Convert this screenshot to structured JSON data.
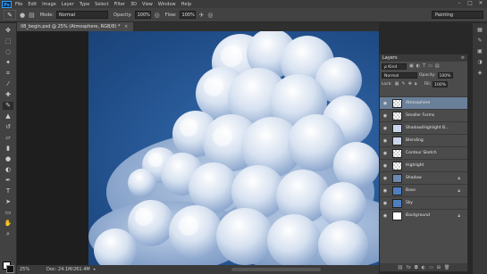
{
  "menubar": {
    "logo": "Ps",
    "items": [
      "File",
      "Edit",
      "Image",
      "Layer",
      "Type",
      "Select",
      "Filter",
      "3D",
      "View",
      "Window",
      "Help"
    ],
    "minimize": "–",
    "maximize": "□",
    "close": "✕"
  },
  "options": {
    "mode_label": "Mode:",
    "mode_value": "Normal",
    "opacity_label": "Opacity:",
    "opacity_value": "100%",
    "flow_label": "Flow:",
    "flow_value": "100%",
    "workspace": "Painting"
  },
  "document": {
    "tab_title": "08_begin.psd @ 25% (Atmosphere, RGB/8) *",
    "tab_close": "×"
  },
  "status": {
    "zoom": "25%",
    "doc": "Doc: 24.1M/261.4M",
    "arrow": "▸"
  },
  "layers_panel": {
    "title": "Layers",
    "filter_kind": "ρ Kind",
    "blend_mode": "Normal",
    "opacity_label": "Opacity:",
    "opacity_value": "100%",
    "lock_label": "Lock:",
    "fill_label": "Fill:",
    "fill_value": "100%",
    "layers": [
      {
        "name": "Atmosphere",
        "thumb": "checker",
        "selected": true,
        "italic": false,
        "locked": false
      },
      {
        "name": "Smaller Forms",
        "thumb": "checker",
        "selected": false,
        "italic": false,
        "locked": false
      },
      {
        "name": "Shadow/Highlight B...",
        "thumb": "cloud",
        "selected": false,
        "italic": false,
        "locked": false
      },
      {
        "name": "Blending",
        "thumb": "cloud",
        "selected": false,
        "italic": false,
        "locked": false
      },
      {
        "name": "Contour Sketch",
        "thumb": "checker",
        "selected": false,
        "italic": false,
        "locked": false
      },
      {
        "name": "Highlight",
        "thumb": "checker",
        "selected": false,
        "italic": false,
        "locked": false
      },
      {
        "name": "Shadow",
        "thumb": "dark",
        "selected": false,
        "italic": false,
        "locked": true
      },
      {
        "name": "Base",
        "thumb": "sky",
        "selected": false,
        "italic": false,
        "locked": true
      },
      {
        "name": "Sky",
        "thumb": "sky",
        "selected": false,
        "italic": false,
        "locked": false
      },
      {
        "name": "Background",
        "thumb": "white",
        "selected": false,
        "italic": true,
        "locked": true
      }
    ]
  },
  "colors": {
    "app_bg": "#282828",
    "panel_bg": "#4b4b4b",
    "selected_layer": "#6a7f99",
    "sky_blue": "#2b5d9c",
    "ps_blue": "#2fa3ff"
  }
}
